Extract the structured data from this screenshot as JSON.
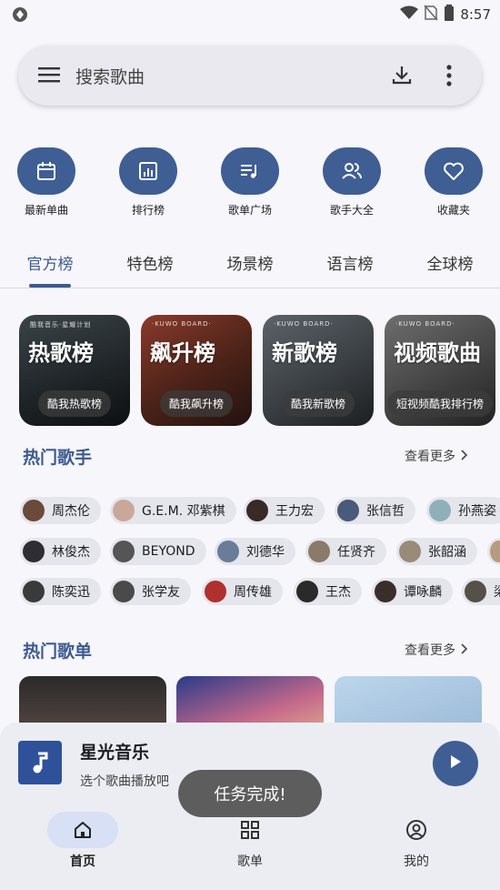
{
  "status_bar": {
    "time": "8:57"
  },
  "search": {
    "placeholder": "搜索歌曲"
  },
  "quick_actions": [
    {
      "label": "最新单曲",
      "icon": "calendar-icon"
    },
    {
      "label": "排行榜",
      "icon": "chart-icon"
    },
    {
      "label": "歌单广场",
      "icon": "playlist-icon"
    },
    {
      "label": "歌手大全",
      "icon": "people-icon"
    },
    {
      "label": "收藏夹",
      "icon": "heart-icon"
    }
  ],
  "tabs": [
    {
      "label": "官方榜",
      "active": true
    },
    {
      "label": "特色榜"
    },
    {
      "label": "场景榜"
    },
    {
      "label": "语言榜"
    },
    {
      "label": "全球榜"
    }
  ],
  "charts": [
    {
      "title": "热歌榜",
      "tag": "酷我热歌榜",
      "brand": "酷我音乐·星耀计划"
    },
    {
      "title": "飙升榜",
      "tag": "酷我飙升榜",
      "brand": "·KUWO BOARD·"
    },
    {
      "title": "新歌榜",
      "tag": "酷我新歌榜",
      "brand": "·KUWO BOARD·"
    },
    {
      "title": "视频歌曲",
      "tag": "短视频酷我排行榜",
      "brand": "·KUWO BOARD·"
    }
  ],
  "hot_artists": {
    "title": "热门歌手",
    "see_more": "查看更多",
    "rows": [
      [
        "周杰伦",
        "G.E.M. 邓紫棋",
        "王力宏",
        "张信哲",
        "孙燕姿"
      ],
      [
        "林俊杰",
        "BEYOND",
        "刘德华",
        "任贤齐",
        "张韶涵"
      ],
      [
        "陈奕迅",
        "张学友",
        "周传雄",
        "王杰",
        "谭咏麟",
        "梁"
      ]
    ]
  },
  "hot_playlists": {
    "title": "热门歌单",
    "see_more": "查看更多"
  },
  "player": {
    "name": "星光音乐",
    "hint": "选个歌曲播放吧"
  },
  "toast": "任务完成!",
  "nav": [
    {
      "label": "首页",
      "active": true
    },
    {
      "label": "歌单"
    },
    {
      "label": "我的"
    }
  ],
  "colors": {
    "accent": "#3d5a8f",
    "chip_bg": "#e5e5ec"
  }
}
